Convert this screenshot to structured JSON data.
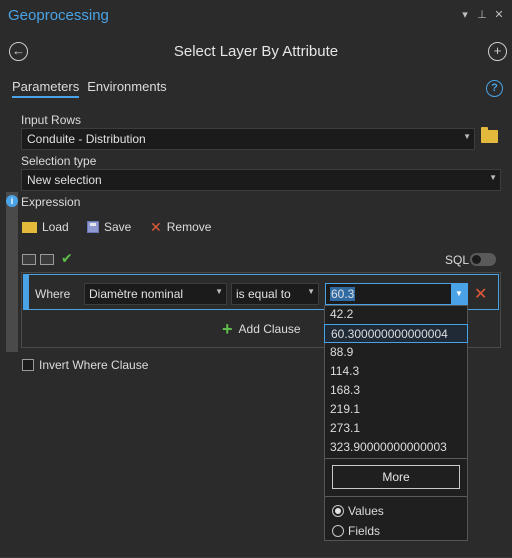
{
  "pane": {
    "title": "Geoprocessing",
    "controls": [
      "▾",
      "⊥",
      "✕"
    ]
  },
  "tool": {
    "title": "Select Layer By Attribute",
    "back_icon": "back-arrow-icon",
    "add_icon": "add-circle-icon"
  },
  "tabs": [
    {
      "label": "Parameters",
      "active": true
    },
    {
      "label": "Environments",
      "active": false
    }
  ],
  "input_rows": {
    "label": "Input Rows",
    "value": "Conduite - Distribution"
  },
  "selection_type": {
    "label": "Selection type",
    "value": "New selection"
  },
  "expression": {
    "label": "Expression",
    "load_label": "Load",
    "save_label": "Save",
    "remove_label": "Remove",
    "sql_label": "SQL"
  },
  "clause": {
    "where_label": "Where",
    "field": "Diamètre nominal",
    "operator": "is equal to",
    "value": "60.3",
    "add_clause_label": "Add Clause"
  },
  "invert_label": "Invert Where Clause",
  "popup": {
    "values": [
      "42.2",
      "60.300000000000004",
      "88.9",
      "114.3",
      "168.3",
      "219.1",
      "273.1",
      "323.90000000000003"
    ],
    "selected_index": 1,
    "more_label": "More",
    "radio_values": "Values",
    "radio_fields": "Fields"
  },
  "colors": {
    "accent": "#4aa3e6",
    "folder": "#e2b93b",
    "remove": "#e05a3a",
    "ok": "#5fbf4a"
  }
}
